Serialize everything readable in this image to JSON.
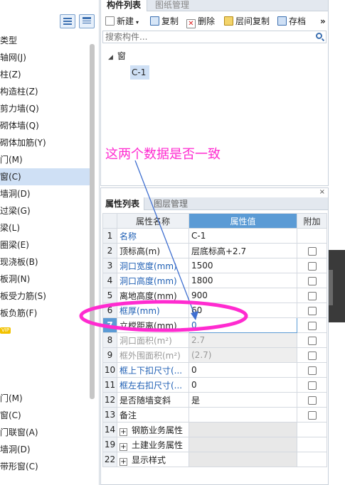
{
  "left_panel": {
    "items": [
      {
        "label": "类型"
      },
      {
        "label": "轴网(J)"
      },
      {
        "label": "柱(Z)"
      },
      {
        "label": "构造柱(Z)"
      },
      {
        "label": "剪力墙(Q)"
      },
      {
        "label": "砌体墙(Q)"
      },
      {
        "label": "砌体加筋(Y)"
      },
      {
        "label": "门(M)"
      },
      {
        "label": "窗(C)",
        "selected": true
      },
      {
        "label": "墙洞(D)"
      },
      {
        "label": "过梁(G)"
      },
      {
        "label": "梁(L)"
      },
      {
        "label": "圈梁(E)"
      },
      {
        "label": "现浇板(B)"
      },
      {
        "label": "板洞(N)"
      },
      {
        "label": "板受力筋(S)"
      },
      {
        "label": "板负筋(F)"
      },
      {
        "label": "",
        "badge": "VIP"
      },
      {
        "label": ""
      },
      {
        "label": ""
      },
      {
        "label": ""
      },
      {
        "label": "门(M)"
      },
      {
        "label": "窗(C)"
      },
      {
        "label": "门联窗(A)"
      },
      {
        "label": "墙洞(D)"
      },
      {
        "label": "带形窗(C)"
      }
    ]
  },
  "component_panel": {
    "tabs": [
      "构件列表",
      "图纸管理"
    ],
    "toolbar": {
      "new": "新建",
      "copy": "复制",
      "delete": "删除",
      "floor_copy": "层间复制",
      "save": "存档",
      "more": "»"
    },
    "search_placeholder": "搜索构件...",
    "tree": {
      "category": "窗",
      "item": "C-1"
    }
  },
  "property_panel": {
    "tabs": [
      "属性列表",
      "图层管理"
    ],
    "close": "×",
    "columns": {
      "no": "",
      "name": "属性名称",
      "value": "属性值",
      "extra": "附加"
    },
    "rows": [
      {
        "no": "1",
        "name": "名称",
        "value": "C-1",
        "name_style": "blue",
        "check": false
      },
      {
        "no": "2",
        "name": "顶标高(m)",
        "value": "层底标高+2.7",
        "name_style": "normal",
        "check": true
      },
      {
        "no": "3",
        "name": "洞口宽度(mm)",
        "value": "1500",
        "name_style": "blue",
        "check": true
      },
      {
        "no": "4",
        "name": "洞口高度(mm)",
        "value": "1800",
        "name_style": "blue",
        "check": true
      },
      {
        "no": "5",
        "name": "离地高度(mm)",
        "value": "900",
        "name_style": "normal",
        "check": true
      },
      {
        "no": "6",
        "name": "框厚(mm)",
        "value": "60",
        "name_style": "blue",
        "check": true
      },
      {
        "no": "7",
        "name": "立樘距离(mm)",
        "value": "0",
        "name_style": "normal",
        "check": true,
        "selected": true
      },
      {
        "no": "8",
        "name": "洞口面积(m²)",
        "value": "2.7",
        "name_style": "gray",
        "check": true
      },
      {
        "no": "9",
        "name": "框外围面积(m²)",
        "value": "(2.7)",
        "name_style": "gray",
        "check": true
      },
      {
        "no": "10",
        "name": "框上下扣尺寸(...",
        "value": "0",
        "name_style": "blue",
        "check": true
      },
      {
        "no": "11",
        "name": "框左右扣尺寸(...",
        "value": "0",
        "name_style": "blue",
        "check": true
      },
      {
        "no": "12",
        "name": "是否随墙变斜",
        "value": "是",
        "name_style": "normal",
        "check": true
      },
      {
        "no": "13",
        "name": "备注",
        "value": "",
        "name_style": "normal",
        "check": true
      },
      {
        "no": "14",
        "name": "钢筋业务属性",
        "value": "",
        "group": true
      },
      {
        "no": "19",
        "name": "土建业务属性",
        "value": "",
        "group": true
      },
      {
        "no": "22",
        "name": "显示样式",
        "value": "",
        "group": true
      }
    ]
  },
  "annotation": {
    "text": "这两个数据是否一致",
    "color": "#ff2bd0"
  },
  "colors": {
    "accent": "#5b9bd5",
    "selection": "#cfe0f5",
    "blue_text": "#1f5fb4"
  }
}
